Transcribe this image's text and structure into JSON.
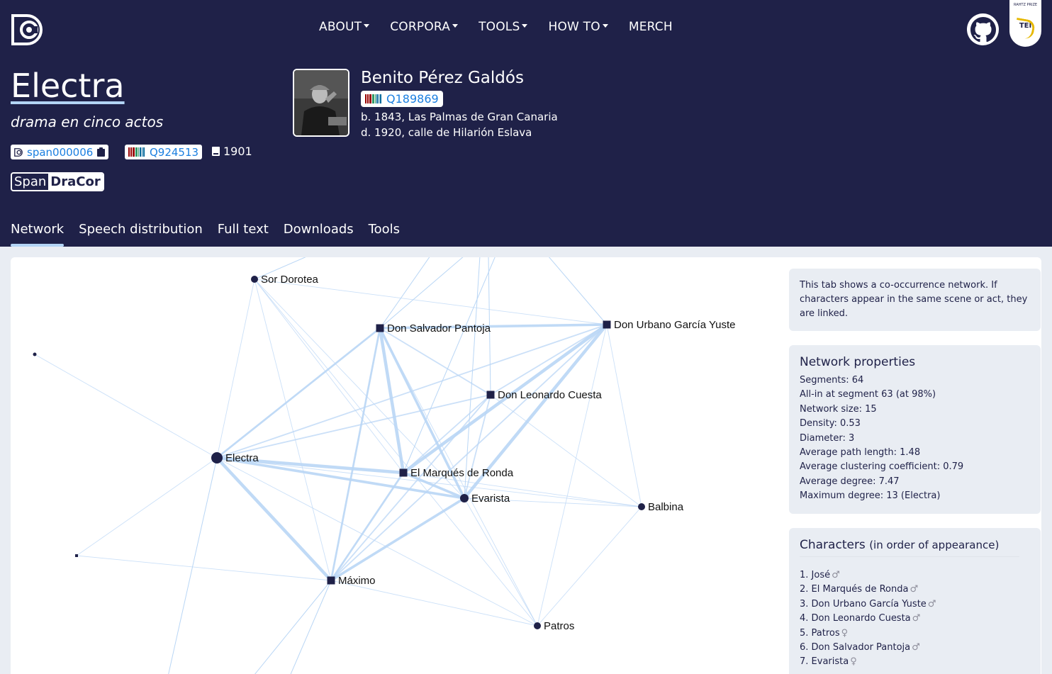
{
  "nav": {
    "items": [
      {
        "label": "ABOUT",
        "dropdown": true
      },
      {
        "label": "CORPORA",
        "dropdown": true
      },
      {
        "label": "TOOLS",
        "dropdown": true
      },
      {
        "label": "HOW TO",
        "dropdown": true
      },
      {
        "label": "MERCH",
        "dropdown": false
      }
    ],
    "badge_small": "RAHTZ PRIZE",
    "badge_year": "2022",
    "badge_tei": "TEI"
  },
  "play": {
    "title": "Electra",
    "subtitle": "drama en cinco actos",
    "id": "span000006",
    "wikidata": "Q924513",
    "year": "1901",
    "corpus_a": "Span",
    "corpus_b": "DraCor"
  },
  "author": {
    "name": "Benito Pérez Galdós",
    "wikidata": "Q189869",
    "born": "b. 1843, Las Palmas de Gran Canaria",
    "died": "d. 1920, calle de Hilarión Eslava"
  },
  "tabs": [
    {
      "label": "Network",
      "active": true
    },
    {
      "label": "Speech distribution",
      "active": false
    },
    {
      "label": "Full text",
      "active": false
    },
    {
      "label": "Downloads",
      "active": false
    },
    {
      "label": "Tools",
      "active": false
    }
  ],
  "info": "This tab shows a co-occurrence network. If characters appear in the same scene or act, they are linked.",
  "properties": {
    "title": "Network properties",
    "lines": [
      "Segments: 64",
      "All-in at segment 63 (at 98%)",
      "Network size: 15",
      "Density: 0.53",
      "Diameter: 3",
      "Average path length: 1.48",
      "Average clustering coefficient: 0.79",
      "Average degree: 7.47",
      "Maximum degree: 13 (Electra)"
    ]
  },
  "characters": {
    "title": "Characters",
    "hint": "(in order of appearance)",
    "items": [
      {
        "label": "1. José",
        "gender": "♂"
      },
      {
        "label": "2. El Marqués de Ronda",
        "gender": "♂"
      },
      {
        "label": "3. Don Urbano García Yuste",
        "gender": "♂"
      },
      {
        "label": "4. Don Leonardo Cuesta",
        "gender": "♂"
      },
      {
        "label": "5. Patros",
        "gender": "♀"
      },
      {
        "label": "6. Don Salvador Pantoja",
        "gender": "♂"
      },
      {
        "label": "7. Evarista",
        "gender": "♀"
      }
    ]
  },
  "network": {
    "nodes": [
      {
        "id": "sor",
        "label": "Sor Dorotea",
        "shape": "circle",
        "size": "small"
      },
      {
        "id": "salvador",
        "label": "Don Salvador Pantoja",
        "shape": "square",
        "size": "medium"
      },
      {
        "id": "urbano",
        "label": "Don Urbano García Yuste",
        "shape": "square",
        "size": "medium"
      },
      {
        "id": "leonardo",
        "label": "Don Leonardo Cuesta",
        "shape": "square",
        "size": "medium"
      },
      {
        "id": "electra",
        "label": "Electra",
        "shape": "circle",
        "size": "large"
      },
      {
        "id": "marques",
        "label": "El Marqués de Ronda",
        "shape": "square",
        "size": "medium"
      },
      {
        "id": "evarista",
        "label": "Evarista",
        "shape": "circle",
        "size": "medium"
      },
      {
        "id": "balbina",
        "label": "Balbina",
        "shape": "circle",
        "size": "small"
      },
      {
        "id": "maximo",
        "label": "Máximo",
        "shape": "square",
        "size": "medium"
      },
      {
        "id": "patros",
        "label": "Patros",
        "shape": "circle",
        "size": "small"
      },
      {
        "id": "dot1",
        "label": "",
        "shape": "circle",
        "size": "tiny"
      },
      {
        "id": "sq1",
        "label": "",
        "shape": "square",
        "size": "tiny"
      }
    ],
    "edges": [
      [
        "salvador",
        "urbano",
        4
      ],
      [
        "salvador",
        "marques",
        5
      ],
      [
        "salvador",
        "evarista",
        4
      ],
      [
        "salvador",
        "electra",
        3
      ],
      [
        "salvador",
        "maximo",
        3
      ],
      [
        "salvador",
        "leonardo",
        2
      ],
      [
        "urbano",
        "marques",
        5
      ],
      [
        "urbano",
        "evarista",
        5
      ],
      [
        "urbano",
        "electra",
        2
      ],
      [
        "urbano",
        "leonardo",
        2
      ],
      [
        "urbano",
        "maximo",
        2
      ],
      [
        "urbano",
        "balbina",
        1
      ],
      [
        "electra",
        "marques",
        5
      ],
      [
        "electra",
        "evarista",
        4
      ],
      [
        "electra",
        "maximo",
        5
      ],
      [
        "electra",
        "leonardo",
        2
      ],
      [
        "electra",
        "dot1",
        1
      ],
      [
        "electra",
        "sq1",
        1
      ],
      [
        "electra",
        "sor",
        1
      ],
      [
        "electra",
        "patros",
        1
      ],
      [
        "electra",
        "balbina",
        1
      ],
      [
        "marques",
        "evarista",
        4
      ],
      [
        "marques",
        "maximo",
        3
      ],
      [
        "marques",
        "balbina",
        1
      ],
      [
        "evarista",
        "maximo",
        4
      ],
      [
        "evarista",
        "balbina",
        1
      ],
      [
        "evarista",
        "patros",
        1
      ],
      [
        "leonardo",
        "marques",
        2
      ],
      [
        "leonardo",
        "evarista",
        2
      ],
      [
        "leonardo",
        "maximo",
        2
      ],
      [
        "leonardo",
        "balbina",
        1
      ],
      [
        "sor",
        "urbano",
        1
      ],
      [
        "sor",
        "marques",
        1
      ],
      [
        "sor",
        "evarista",
        1
      ],
      [
        "sor",
        "patros",
        1
      ],
      [
        "sor",
        "maximo",
        1
      ],
      [
        "maximo",
        "patros",
        1
      ],
      [
        "maximo",
        "sq1",
        1
      ],
      [
        "patros",
        "balbina",
        1
      ],
      [
        "patros",
        "salvador",
        1
      ],
      [
        "patros",
        "urbano",
        1
      ]
    ]
  }
}
